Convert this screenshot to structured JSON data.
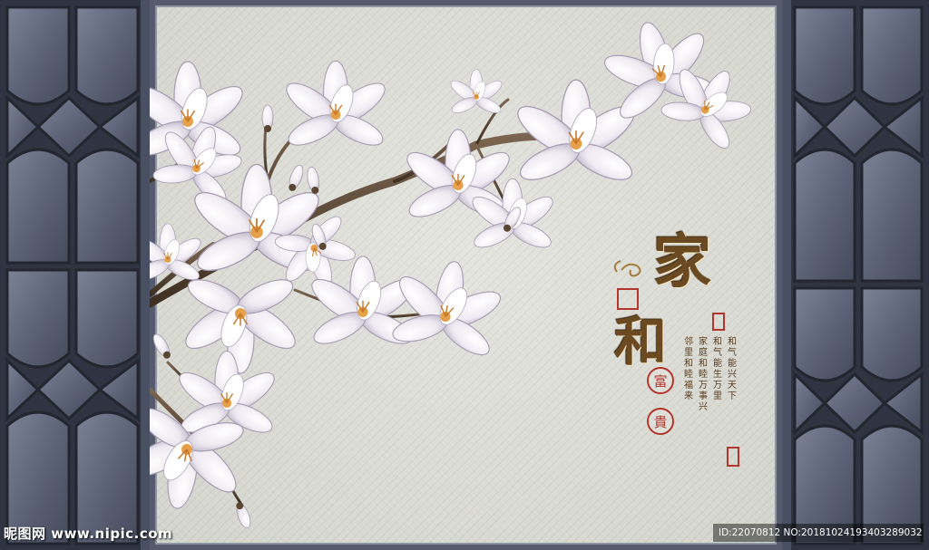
{
  "calligraphy": {
    "main_top": "家",
    "main_bottom": "和",
    "seal_round_1": "富",
    "seal_round_2": "貴"
  },
  "poem_columns": [
    "和气能兴天下",
    "和气能生万里",
    "家庭和睦万事兴",
    "邻里和睦福来"
  ],
  "watermark": {
    "site": "昵图网 www.nipic.com",
    "id_text": "ID:22070812 NO:20181024193403289032"
  },
  "colors": {
    "panel": "#3a3f52",
    "wall": "#d8d9d2",
    "blossom": "#f4f0f6",
    "branch": "#5a4632",
    "seal_red": "#b4352b",
    "gold": "#6b4a22"
  }
}
